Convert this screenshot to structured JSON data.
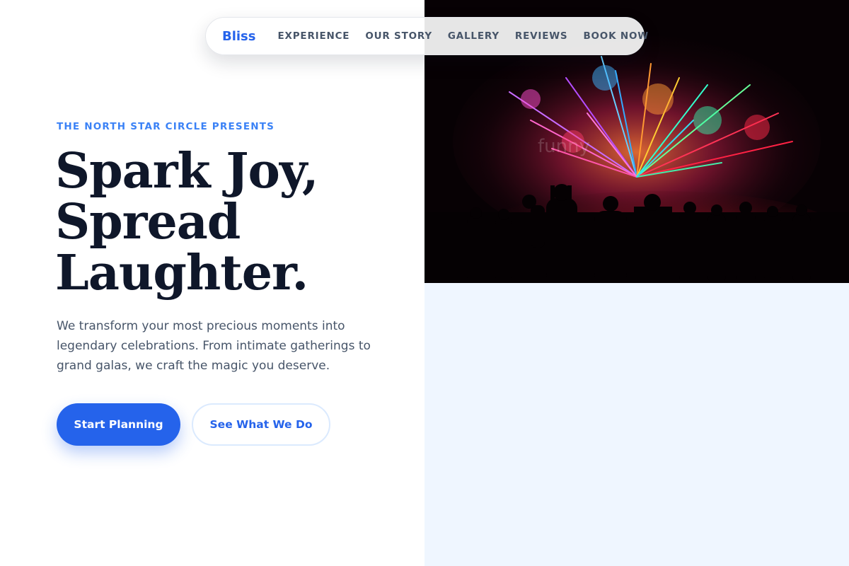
{
  "nav": {
    "brand": "Bliss",
    "links": [
      "EXPERIENCE",
      "OUR STORY",
      "GALLERY",
      "REVIEWS",
      "BOOK NOW"
    ]
  },
  "hero": {
    "eyebrow": "THE NORTH STAR CIRCLE PRESENTS",
    "headline_lines": [
      "Spark Joy,",
      "Spread",
      "Laughter."
    ],
    "lead": "We transform your most precious moments into legendary celebrations. From intimate gatherings to grand galas, we craft the magic you deserve.",
    "primary_button": "Start Planning",
    "secondary_button": "See What We Do"
  },
  "image": {
    "subject": "fireworks-over-crowd",
    "watermark": "funny"
  },
  "colors": {
    "accent": "#2563eb",
    "eyebrow": "#3b82f6",
    "heading": "#0f172a",
    "body_text": "#475569",
    "panel": "#eff6ff"
  }
}
